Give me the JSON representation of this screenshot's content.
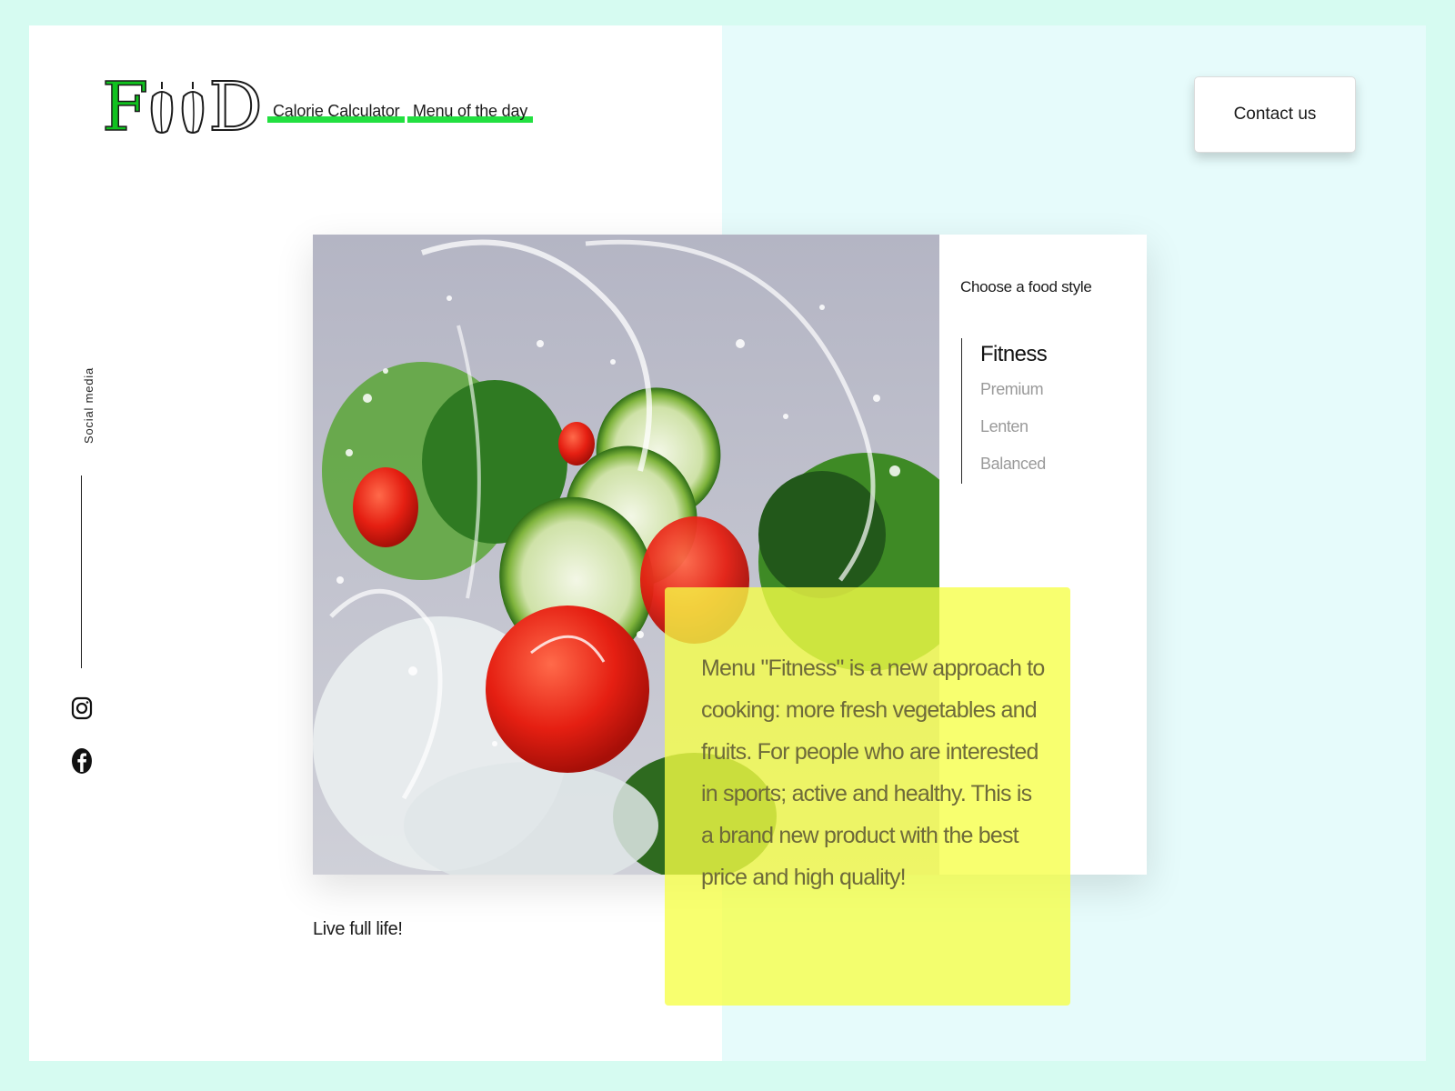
{
  "brand": {
    "logo_text_first": "F",
    "logo_text_last": "D"
  },
  "nav": {
    "items": [
      {
        "label": "Calorie Calculator"
      },
      {
        "label": "Menu of the day"
      }
    ]
  },
  "header": {
    "contact_label": "Contact us"
  },
  "social": {
    "label": "Social media",
    "icons": [
      "instagram-icon",
      "facebook-icon"
    ]
  },
  "panel": {
    "title": "Choose a food style",
    "styles": [
      {
        "label": "Fitness",
        "active": true
      },
      {
        "label": "Premium",
        "active": false
      },
      {
        "label": "Lenten",
        "active": false
      },
      {
        "label": "Balanced",
        "active": false
      }
    ]
  },
  "hero": {
    "tagline": "Live full life!"
  },
  "description": {
    "text": "Menu \"Fitness\" is a new approach to cooking: more fresh vegetables and fruits. For people who are interested in sports; active and healthy. This is a brand new product with the best price and high quality!"
  },
  "colors": {
    "page_bg": "#d6fbf1",
    "accent_green": "#22e040",
    "highlight_yellow": "#f6ff46",
    "right_panel_bg": "#e6fbfb"
  }
}
